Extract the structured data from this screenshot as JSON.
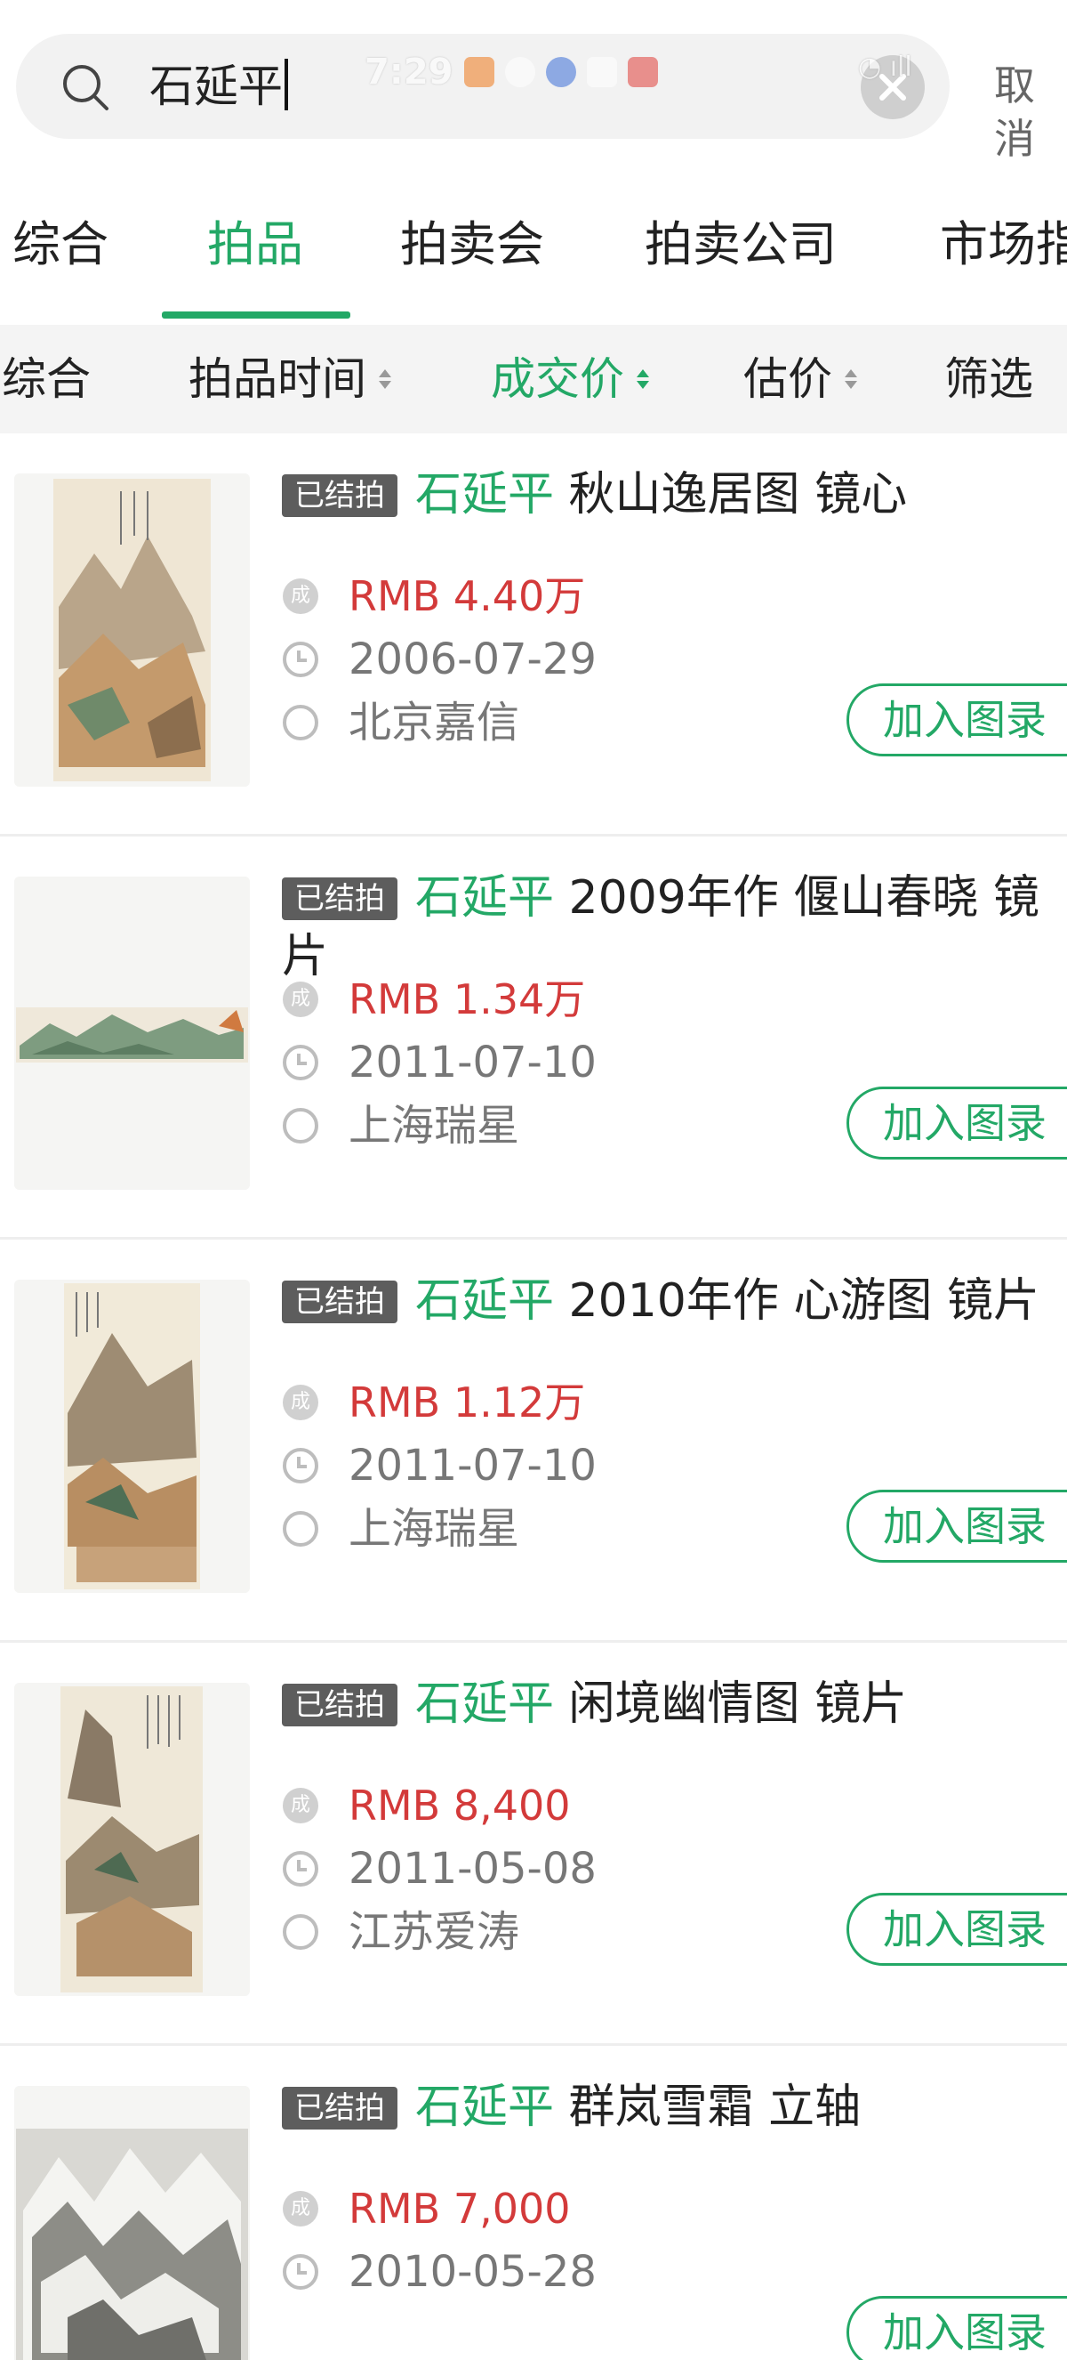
{
  "search": {
    "query": "石延平",
    "cancel_label": "取消"
  },
  "status_bar": {
    "time": "7:29"
  },
  "tabs": [
    {
      "label": "综合"
    },
    {
      "label": "拍品"
    },
    {
      "label": "拍卖会"
    },
    {
      "label": "拍卖公司"
    },
    {
      "label": "市场指"
    }
  ],
  "filters": [
    {
      "label": "综合"
    },
    {
      "label": "拍品时间"
    },
    {
      "label": "成交价"
    },
    {
      "label": "估价"
    },
    {
      "label": "筛选"
    }
  ],
  "items": [
    {
      "badge": "已结拍",
      "artist": "石延平",
      "title": " 秋山逸居图 镜心",
      "price": "RMB 4.40万",
      "date": "2006-07-29",
      "house": "北京嘉信",
      "button": "加入图录"
    },
    {
      "badge": "已结拍",
      "artist": "石延平",
      "title": " 2009年作 偃山春晓 镜片",
      "price": "RMB 1.34万",
      "date": "2011-07-10",
      "house": "上海瑞星",
      "button": "加入图录"
    },
    {
      "badge": "已结拍",
      "artist": "石延平",
      "title": " 2010年作 心游图 镜片",
      "price": "RMB 1.12万",
      "date": "2011-07-10",
      "house": "上海瑞星",
      "button": "加入图录"
    },
    {
      "badge": "已结拍",
      "artist": "石延平",
      "title": " 闲境幽情图 镜片",
      "price": "RMB 8,400",
      "date": "2011-05-08",
      "house": "江苏爱涛",
      "button": "加入图录"
    },
    {
      "badge": "已结拍",
      "artist": "石延平",
      "title": " 群岚雪霜 立轴",
      "price": "RMB 7,000",
      "date": "2010-05-28",
      "house": "",
      "button": "加入图录"
    }
  ],
  "icons": {
    "price_icon_glyph": "成"
  },
  "colors": {
    "accent": "#23a866",
    "price": "#d33a3a",
    "badge_bg": "#5d5d5d"
  }
}
